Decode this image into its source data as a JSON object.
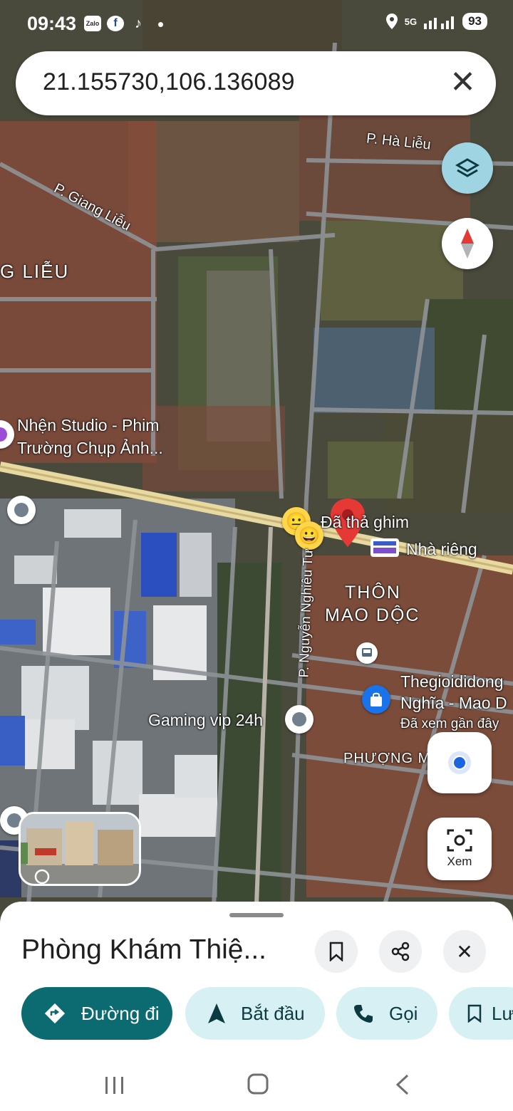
{
  "status_bar": {
    "time": "09:43",
    "apps": [
      "Zalo",
      "f",
      "♪"
    ],
    "network": "5G",
    "battery": "93"
  },
  "search": {
    "query": "21.155730,106.136089",
    "clear_icon": "close-icon"
  },
  "map_labels": {
    "street_ha_lieu": "P. Hà Liễu",
    "street_giang_lieu": "P. Giang Liễu",
    "area_giang_lieu": "G LIỄU",
    "poi_nhen_studio_line1": "Nhện Studio - Phim",
    "poi_nhen_studio_line2": "Trường Chụp Ảnh...",
    "dropped_pin": "Đã thả ghim",
    "home": "Nhà riêng",
    "village_line1": "THÔN",
    "village_line2": "MAO DỘC",
    "street_nguyen_nghieu_tu": "P. Nguyễn Nghiêu Tư",
    "poi_thegioididong_line1": "Thegioididong",
    "poi_thegioididong_line2": "Nghĩa - Mao D",
    "poi_thegioididong_note": "Đã xem gần đây",
    "gaming": "Gaming vip 24h",
    "ward": "PHƯỢNG M"
  },
  "controls": {
    "layers_icon": "layers-icon",
    "compass_icon": "compass-icon",
    "my_location_icon": "my-location-icon",
    "lens_label": "Xem"
  },
  "place": {
    "title": "Phòng Khám Thiệ...",
    "save_icon": "bookmark-icon",
    "share_icon": "share-icon",
    "close_icon": "close-icon"
  },
  "actions": [
    {
      "label": "Đường đi",
      "icon": "directions-icon"
    },
    {
      "label": "Bắt đầu",
      "icon": "navigation-arrow-icon"
    },
    {
      "label": "Gọi",
      "icon": "phone-icon"
    },
    {
      "label": "Lư",
      "icon": "bookmark-icon"
    }
  ],
  "colors": {
    "primary": "#0b6b71",
    "chip": "#d7f0f4",
    "pin": "#e53935",
    "layers_button": "#9fd4e2"
  }
}
